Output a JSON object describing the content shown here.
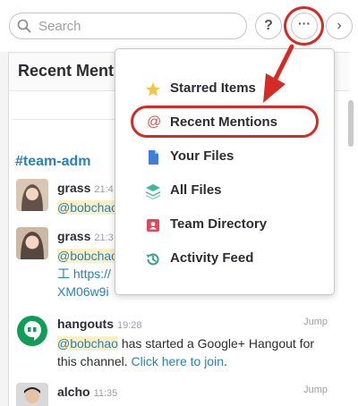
{
  "search": {
    "placeholder": "Search"
  },
  "toolbar": {
    "help_label": "?",
    "more_label": "···",
    "chevron_label": "›"
  },
  "panel": {
    "title": "Recent Mentions"
  },
  "channel": "#team-adm",
  "messages": [
    {
      "author": "grass",
      "time": "21:4",
      "lines": [
        "@bobchao"
      ]
    },
    {
      "author": "grass",
      "time": "21:3",
      "lines": [
        "@bobchao",
        "工 https://",
        "XM06w9i"
      ]
    },
    {
      "author": "hangouts",
      "time": "19:28",
      "jump": "Jump",
      "mention": "@bobchao",
      "text": " has started a Google+ Hangout for this channel. ",
      "link": "Click here to join",
      "tail": "."
    },
    {
      "author": "alcho",
      "time": "11:35",
      "jump": "Jump"
    }
  ],
  "menu": {
    "items": [
      {
        "label": "Starred Items",
        "icon": "star-icon",
        "color": "#f4c542"
      },
      {
        "label": "Recent Mentions",
        "icon": "at-icon",
        "color": "#d9534f"
      },
      {
        "label": "Your Files",
        "icon": "file-icon",
        "color": "#3f7fd8"
      },
      {
        "label": "All Files",
        "icon": "stack-icon",
        "color": "#3fb89b"
      },
      {
        "label": "Team Directory",
        "icon": "directory-icon",
        "color": "#e0475a"
      },
      {
        "label": "Activity Feed",
        "icon": "history-icon",
        "color": "#3a9f86"
      }
    ]
  },
  "colors": {
    "annotation": "#d52b26",
    "link": "#2a80b9",
    "mention_bg": "#fdf0c2"
  }
}
